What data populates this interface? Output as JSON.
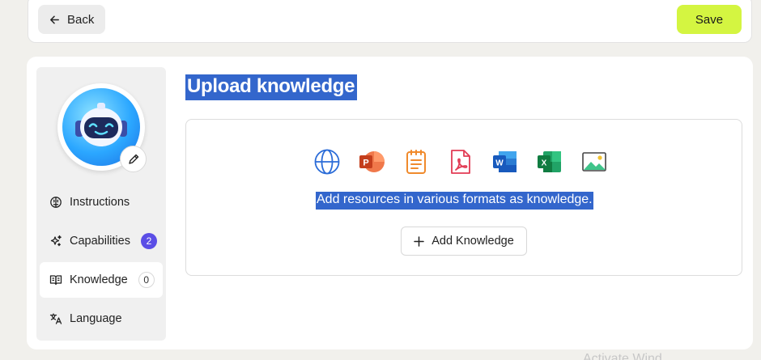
{
  "header": {
    "back_label": "Back",
    "save_label": "Save"
  },
  "sidebar": {
    "items": [
      {
        "label": "Instructions",
        "icon": "brain-icon"
      },
      {
        "label": "Capabilities",
        "icon": "sparkles-icon",
        "badge": "2"
      },
      {
        "label": "Knowledge",
        "icon": "book-icon",
        "badge": "0",
        "active": true
      },
      {
        "label": "Language",
        "icon": "translate-icon"
      }
    ]
  },
  "main": {
    "title": "Upload knowledge",
    "description": "Add resources in various formats as knowledge.",
    "add_button_label": "Add Knowledge",
    "format_icons": [
      "globe-icon",
      "powerpoint-icon",
      "text-file-icon",
      "pdf-icon",
      "word-icon",
      "excel-icon",
      "image-icon"
    ]
  },
  "watermark": "Activate Wind",
  "colors": {
    "accent": "#5b4ee6",
    "save": "#d4f541",
    "selection": "#3366cc"
  }
}
